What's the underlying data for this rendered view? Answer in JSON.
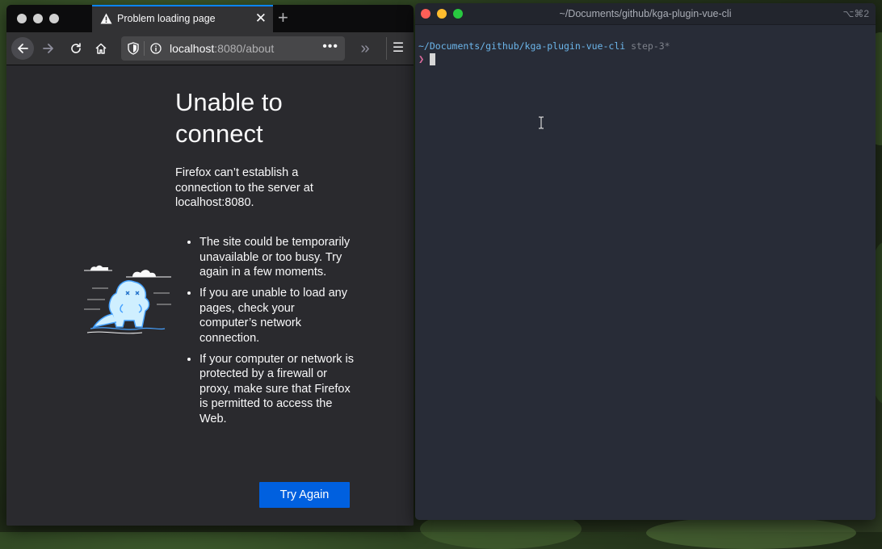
{
  "browser": {
    "tab": {
      "title": "Problem loading page",
      "close": "✕"
    },
    "new_tab": "+",
    "url": {
      "host": "localhost",
      "rest": ":8080/about",
      "page_actions": "•••"
    },
    "overflow": "»",
    "menu": "☰",
    "error": {
      "title": "Unable to connect",
      "description": "Firefox can’t establish a connection to the server at localhost:8080.",
      "items": [
        "The site could be temporarily unavailable or too busy. Try again in a few moments.",
        "If you are unable to load any pages, check your computer’s network connection.",
        "If your computer or network is protected by a firewall or proxy, make sure that Firefox is permitted to access the Web."
      ],
      "button": "Try Again"
    }
  },
  "terminal": {
    "title": "~/Documents/github/kga-plugin-vue-cli",
    "shortcut": "⌥⌘2",
    "cwd": "~/Documents/github/kga-plugin-vue-cli",
    "branch": "step-3*",
    "prompt": "❯"
  },
  "colors": {
    "accent": "#0060df",
    "tab_highlight": "#0a84ff",
    "terminal_path": "#6cb6eb",
    "terminal_prompt": "#e06c9f"
  },
  "icons": [
    "back-arrow-icon",
    "forward-arrow-icon",
    "reload-icon",
    "home-icon",
    "shield-icon",
    "info-icon",
    "warning-icon",
    "overflow-chevron-icon",
    "hamburger-menu-icon",
    "text-cursor-icon"
  ]
}
